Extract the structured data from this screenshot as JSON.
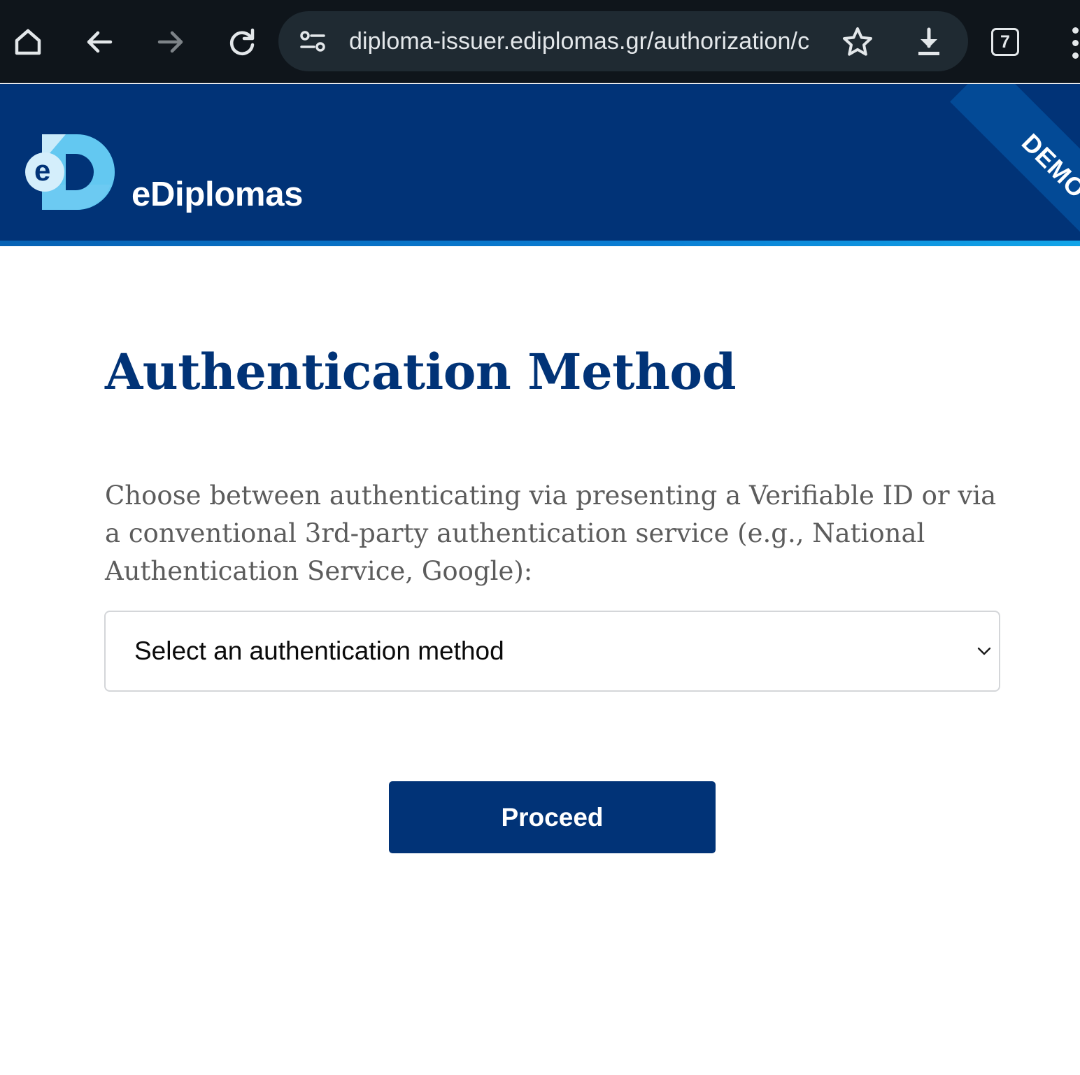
{
  "browser": {
    "url": "diploma-issuer.ediplomas.gr/authorization/c",
    "tab_count": "7",
    "icons": [
      "home-icon",
      "back-icon",
      "forward-icon",
      "reload-icon",
      "site-info-icon",
      "bookmark-star-icon",
      "download-icon",
      "tabs-icon",
      "menu-icon"
    ]
  },
  "header": {
    "brand_name": "eDiplomas",
    "logo_letter": "e",
    "ribbon": "DEMO"
  },
  "main": {
    "title": "Authentication Method",
    "description": "Choose between authenticating via presenting a Verifiable ID or via a conventional 3rd-party authentication service (e.g., National Authentication Service, Google):",
    "select": {
      "selected": "Select an authentication method"
    },
    "proceed_label": "Proceed"
  },
  "colors": {
    "brand_navy": "#013377",
    "browser_bg": "#0f151b",
    "omnibox_bg": "#1f2a32",
    "description_text": "#5c5c5c"
  }
}
